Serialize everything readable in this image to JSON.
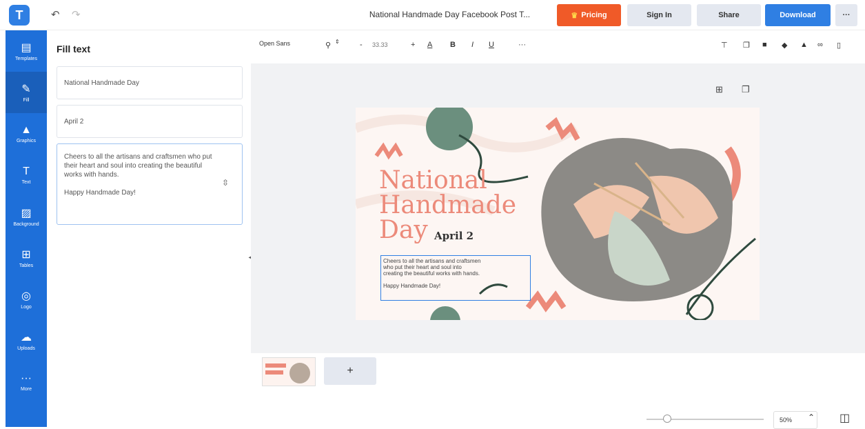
{
  "header": {
    "logo_text": "T",
    "undo_icon": "undo-icon",
    "redo_icon": "redo-icon",
    "doc_title": "National Handmade Day Facebook Post T...",
    "pricing_label": "Pricing",
    "signin_label": "Sign In",
    "share_label": "Share",
    "download_label": "Download",
    "more_label": "···",
    "colors": {
      "pricing": "#f05a28",
      "download": "#2f7fe3",
      "secondary": "#e4e8f0"
    }
  },
  "sidebar": {
    "color": "#1e6fd9",
    "items": [
      {
        "label": "Templates",
        "icon": "templates-icon"
      },
      {
        "label": "Fill",
        "icon": "brush-icon"
      },
      {
        "label": "Graphics",
        "icon": "shapes-icon"
      },
      {
        "label": "Text",
        "icon": "text-icon"
      },
      {
        "label": "Background",
        "icon": "background-icon"
      },
      {
        "label": "Tables",
        "icon": "table-icon"
      },
      {
        "label": "Logo",
        "icon": "logo-icon"
      },
      {
        "label": "Uploads",
        "icon": "upload-icon"
      },
      {
        "label": "More",
        "icon": "more-icon"
      }
    ]
  },
  "panel": {
    "title": "Fill text",
    "fields": [
      "National Handmade Day",
      "April 2",
      "Cheers to all the artisans and craftsmen who put their heart and soul into creating the beautiful works with hands.\n\nHappy Handmade Day!"
    ]
  },
  "toolbar": {
    "font_name": "Open Sans",
    "font_size": "33.33",
    "minus": "-",
    "plus": "+",
    "bold": "B",
    "italic": "I",
    "underline": "U",
    "more": "···"
  },
  "poster": {
    "title_line1": "National",
    "title_line2": "Handmade",
    "title_line3": "Day",
    "date": "April 2",
    "body": "Cheers to all the artisans and craftsmen\nwho put their heart and soul into\ncreating the beautiful works with hands.\n\nHappy Handmade Day!",
    "accent_color": "#ec8a7a"
  },
  "bottom": {
    "add_page_label": "+",
    "zoom_value": "50%",
    "zoom_fraction": 0.15
  }
}
